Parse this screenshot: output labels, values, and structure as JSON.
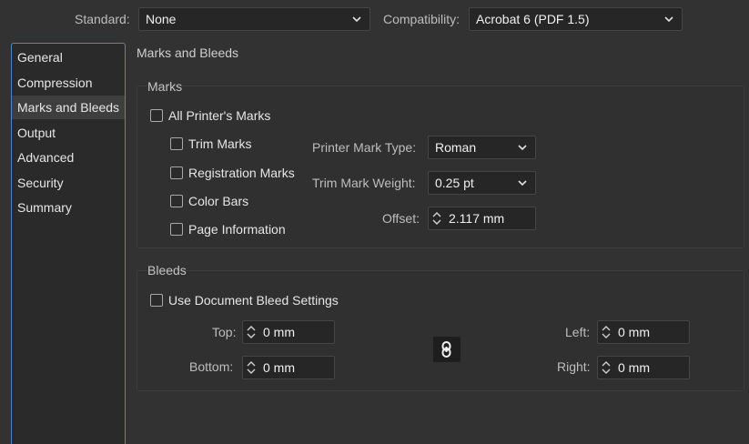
{
  "top": {
    "standard_label": "Standard:",
    "standard_value": "None",
    "compat_label": "Compatibility:",
    "compat_value": "Acrobat 6 (PDF 1.5)"
  },
  "sidebar": {
    "items": [
      {
        "label": "General"
      },
      {
        "label": "Compression"
      },
      {
        "label": "Marks and Bleeds",
        "active": true
      },
      {
        "label": "Output"
      },
      {
        "label": "Advanced"
      },
      {
        "label": "Security"
      },
      {
        "label": "Summary"
      }
    ]
  },
  "page_title": "Marks and Bleeds",
  "marks": {
    "title": "Marks",
    "all_printers_marks": "All Printer's Marks",
    "trim_marks": "Trim Marks",
    "registration_marks": "Registration Marks",
    "color_bars": "Color Bars",
    "page_information": "Page Information",
    "printer_mark_type_label": "Printer Mark Type:",
    "printer_mark_type_value": "Roman",
    "trim_mark_weight_label": "Trim Mark Weight:",
    "trim_mark_weight_value": "0.25 pt",
    "offset_label": "Offset:",
    "offset_value": "2.117 mm"
  },
  "bleeds": {
    "title": "Bleeds",
    "use_document_bleed": "Use Document Bleed Settings",
    "top_label": "Top:",
    "top_value": "0 mm",
    "bottom_label": "Bottom:",
    "bottom_value": "0 mm",
    "left_label": "Left:",
    "left_value": "0 mm",
    "right_label": "Right:",
    "right_value": "0 mm"
  },
  "icons": {
    "chevron": "chevron-down-icon",
    "spinner": "spinner-arrows-icon",
    "link": "chain-link-icon"
  },
  "colors": {
    "background": "#323232",
    "accent_border": "#4b88c9",
    "field_bg": "#262626"
  }
}
